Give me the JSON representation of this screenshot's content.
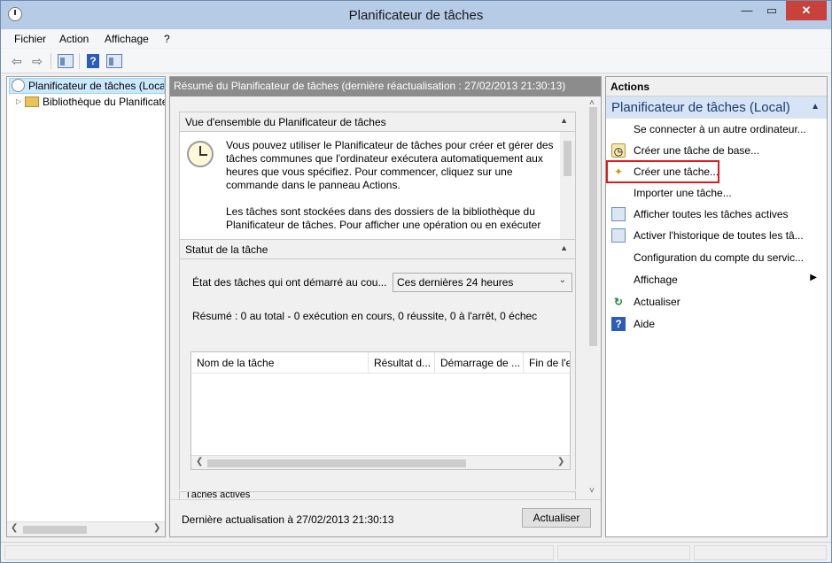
{
  "window": {
    "title": "Planificateur de tâches",
    "minimize_glyph": "—",
    "maximize_glyph": "▭",
    "close_glyph": "✕"
  },
  "menu": {
    "items": [
      "Fichier",
      "Action",
      "Affichage",
      "?"
    ]
  },
  "toolbar": {
    "back_icon": "back-arrow-icon",
    "forward_icon": "forward-arrow-icon",
    "show_tree_icon": "show-hide-console-tree-icon",
    "help_icon": "help-icon",
    "show_action_pane_icon": "show-hide-action-pane-icon",
    "help_glyph": "?"
  },
  "tree": {
    "root_label": "Planificateur de tâches (Local)",
    "child_label": "Bibliothèque du Planificateur de tâches",
    "expander_glyph": "▷"
  },
  "middle": {
    "header": "Résumé du Planificateur de tâches (dernière réactualisation : 27/02/2013 21:30:13)",
    "overview": {
      "title": "Vue d'ensemble du Planificateur de tâches",
      "paragraph1": "Vous pouvez utiliser le Planificateur de tâches pour créer et gérer des tâches communes que l'ordinateur exécutera automatiquement aux heures que vous spécifiez. Pour commencer, cliquez sur une commande dans le panneau Actions.",
      "paragraph2": "Les tâches sont stockées dans des dossiers de la bibliothèque du Planificateur de tâches. Pour afficher une opération ou en exécuter"
    },
    "status": {
      "title": "Statut de la tâche",
      "label": "État des tâches qui ont démarré au cou...",
      "combo_value": "Ces dernières 24 heures",
      "summary": "Résumé : 0 au total - 0 exécution en cours, 0 réussite, 0 à l'arrêt, 0 échec",
      "columns": [
        "Nom de la tâche",
        "Résultat d...",
        "Démarrage de ...",
        "Fin de l'e"
      ]
    },
    "active_tasks_title": "Tâches actives",
    "footer": {
      "last_refresh": "Dernière actualisation à 27/02/2013 21:30:13",
      "refresh_button": "Actualiser"
    },
    "collapse_glyph": "▲",
    "combo_arrow": "⌄"
  },
  "actions": {
    "title": "Actions",
    "group": "Planificateur de tâches (Local)",
    "items": [
      {
        "label": "Se connecter à un autre ordinateur...",
        "icon": "none"
      },
      {
        "label": "Créer une tâche de base...",
        "icon": "basic-task-icon"
      },
      {
        "label": "Créer une tâche...",
        "icon": "create-task-icon"
      },
      {
        "label": "Importer une tâche...",
        "icon": "none"
      },
      {
        "label": "Afficher toutes les tâches actives",
        "icon": "list-icon"
      },
      {
        "label": "Activer l'historique de toutes les tâ...",
        "icon": "history-icon"
      },
      {
        "label": "Configuration du compte du servic...",
        "icon": "none"
      },
      {
        "label": "Affichage",
        "icon": "none",
        "submenu": true
      },
      {
        "label": "Actualiser",
        "icon": "refresh-icon"
      },
      {
        "label": "Aide",
        "icon": "help-icon"
      }
    ],
    "highlighted_item": "Créer une tâche...",
    "highlight_color": "#e0181f",
    "submenu_glyph": "▶"
  },
  "colors": {
    "title_bar": "#b6cbe6",
    "close_button": "#c8413a",
    "middle_header": "#8c8c8c",
    "actions_group": "#d6e4f5",
    "tree_selection": "#cce8ff"
  }
}
